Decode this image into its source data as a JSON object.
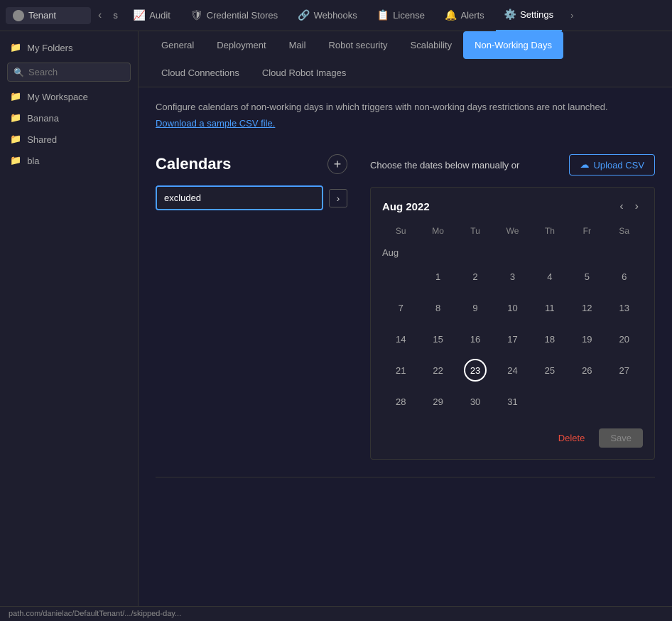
{
  "topNav": {
    "tenant": "Tenant",
    "items": [
      {
        "id": "audit",
        "label": "Audit",
        "icon": "📈",
        "active": false
      },
      {
        "id": "credential-stores",
        "label": "Credential Stores",
        "icon": "🛡",
        "active": false
      },
      {
        "id": "webhooks",
        "label": "Webhooks",
        "icon": "🔗",
        "active": false
      },
      {
        "id": "license",
        "label": "License",
        "icon": "📋",
        "active": false
      },
      {
        "id": "alerts",
        "label": "Alerts",
        "icon": "🔔",
        "active": false
      },
      {
        "id": "settings",
        "label": "Settings",
        "icon": "⚙️",
        "active": true
      }
    ]
  },
  "sidebar": {
    "search": {
      "placeholder": "Search",
      "value": ""
    },
    "items": [
      {
        "id": "my-folders",
        "label": "My Folders",
        "icon": "📁"
      },
      {
        "id": "my-workspace",
        "label": "My Workspace",
        "icon": "📁"
      },
      {
        "id": "banana",
        "label": "Banana",
        "icon": "📁"
      },
      {
        "id": "shared",
        "label": "Shared",
        "icon": "📁"
      },
      {
        "id": "bla",
        "label": "bla",
        "icon": "📁"
      }
    ]
  },
  "settingsTabs": {
    "tabs": [
      {
        "id": "general",
        "label": "General",
        "active": false
      },
      {
        "id": "deployment",
        "label": "Deployment",
        "active": false
      },
      {
        "id": "mail",
        "label": "Mail",
        "active": false
      },
      {
        "id": "robot-security",
        "label": "Robot security",
        "active": false
      },
      {
        "id": "scalability",
        "label": "Scalability",
        "active": false
      },
      {
        "id": "non-working-days",
        "label": "Non-Working Days",
        "active": true
      },
      {
        "id": "cloud-connections",
        "label": "Cloud Connections",
        "active": false
      },
      {
        "id": "cloud-robot-images",
        "label": "Cloud Robot Images",
        "active": false
      }
    ]
  },
  "mainContent": {
    "description": "Configure calendars of non-working days in which triggers with non-working days restrictions are not launched.",
    "downloadLink": "Download a sample CSV file.",
    "calendarsTitle": "Calendars",
    "addButton": "+",
    "calendarEntry": {
      "value": "excluded",
      "arrowIcon": "›"
    },
    "chooseDatesText": "Choose the dates below manually or",
    "uploadCsvLabel": "Upload CSV",
    "calendar": {
      "monthYear": "Aug 2022",
      "weekdays": [
        "Su",
        "Mo",
        "Tu",
        "We",
        "Th",
        "Fr",
        "Sa"
      ],
      "monthLabel": "Aug",
      "weeks": [
        [
          null,
          1,
          2,
          3,
          4,
          5,
          6
        ],
        [
          7,
          8,
          9,
          10,
          11,
          12,
          13
        ],
        [
          14,
          15,
          16,
          17,
          18,
          19,
          20
        ],
        [
          21,
          22,
          23,
          24,
          25,
          26,
          27
        ],
        [
          28,
          29,
          30,
          31,
          null,
          null,
          null
        ]
      ],
      "selectedDay": 23
    },
    "deleteLabel": "Delete",
    "saveLabel": "Save"
  },
  "statusBar": {
    "url": "path.com/danielac/DefaultTenant/.../skipped-day..."
  }
}
